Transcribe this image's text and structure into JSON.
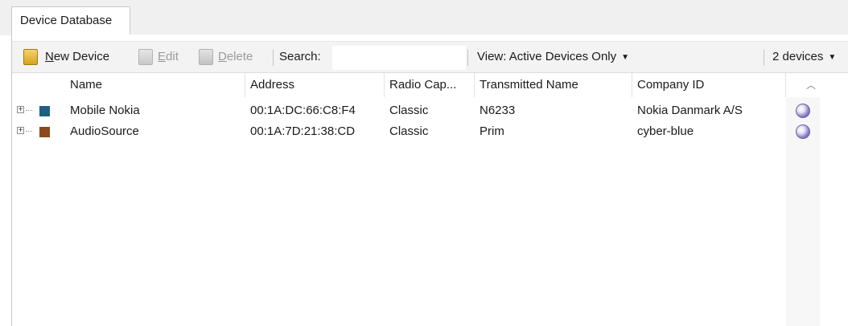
{
  "tab": {
    "label": "Device Database"
  },
  "toolbar": {
    "new_prefix": "N",
    "new_rest": "ew Device",
    "edit_prefix": "E",
    "edit_rest": "dit",
    "delete_prefix": "D",
    "delete_rest": "elete",
    "search_label": "Search:",
    "search_value": "",
    "view_label": "View: Active Devices Only",
    "count_label": "2 devices"
  },
  "columns": [
    "Name",
    "Address",
    "Radio Cap...",
    "Transmitted Name",
    "Company ID"
  ],
  "rows": [
    {
      "color": "#1f5f84",
      "name": "Mobile Nokia",
      "address": "00:1A:DC:66:C8:F4",
      "radio": "Classic",
      "transmitted": "N6233",
      "company": "Nokia Danmark A/S"
    },
    {
      "color": "#8a4a1e",
      "name": "AudioSource",
      "address": "00:1A:7D:21:38:CD",
      "radio": "Classic",
      "transmitted": "Prim",
      "company": "cyber-blue"
    }
  ],
  "icons": {
    "new": "new-device-icon",
    "edit": "edit-icon",
    "delete": "delete-icon",
    "dropdown": "chevron-down-icon",
    "sort": "sort-up-icon",
    "row": "device-status-icon",
    "expand": "expand-plus-icon"
  }
}
